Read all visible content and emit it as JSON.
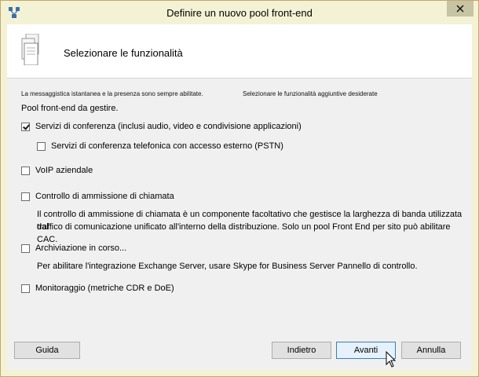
{
  "window": {
    "title": "Definire un nuovo pool front-end"
  },
  "header": {
    "title": "Selezionare le funzionalità"
  },
  "info": {
    "im_presence_note": "La messaggistica istantanea e la presenza sono sempre abilitate.",
    "select_features_hint": "Selezionare le funzionalità aggiuntive desiderate",
    "pool_text": "Pool front-end da gestire."
  },
  "features": {
    "conferencing": {
      "label": "Servizi di conferenza (inclusi audio, video e condivisione applicazioni)",
      "checked": true
    },
    "dial_in": {
      "label": "Servizi di conferenza telefonica con accesso esterno (PSTN)",
      "checked": false
    },
    "voip": {
      "label": "VoIP aziendale",
      "checked": false
    },
    "cac": {
      "label": "Controllo di ammissione di chiamata",
      "checked": false,
      "desc_line1": "Il controllo di ammissione di chiamata è un componente facoltativo che gestisce la larghezza di banda utilizzata dal",
      "desc_line2": "traffico di comunicazione unificato all'interno della distribuzione. Solo un pool Front End per sito può abilitare CAC."
    },
    "archiving": {
      "label": "Archiviazione in corso...",
      "checked": false,
      "desc": "Per abilitare l'integrazione Exchange Server, usare Skype for Business Server Pannello di controllo."
    },
    "monitoring": {
      "label": "Monitoraggio (metriche CDR e DoE)",
      "checked": false
    }
  },
  "buttons": {
    "help": "Guida",
    "back": "Indietro",
    "next": "Avanti",
    "cancel": "Annulla"
  },
  "colors": {
    "titlebar": "#f4f2d4",
    "default_button_border": "#3c7fb1"
  }
}
